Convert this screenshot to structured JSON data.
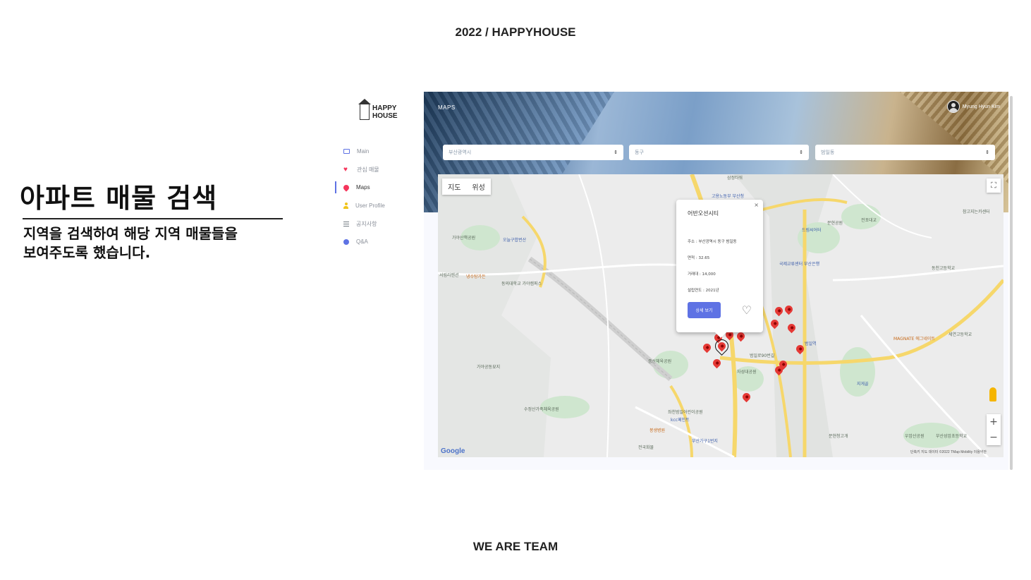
{
  "slide": {
    "header": "2022 / HAPPYHOUSE",
    "title": "아파트 매물 검색",
    "description_line1": "지역을 검색하여 해당 지역 매물들을",
    "description_line2": "보여주도록 했습니다.",
    "footer": "WE ARE TEAM"
  },
  "app": {
    "logo_line1": "HAPPY",
    "logo_line2": "HOUSE",
    "page_label": "MAPS",
    "user_name": "Myung Hyun Kim",
    "sidebar": {
      "items": [
        {
          "label": "Main",
          "icon": "monitor-icon",
          "color": "#5e72e4",
          "active": false
        },
        {
          "label": "관심 매물",
          "icon": "heart-icon",
          "color": "#f5365c",
          "active": false
        },
        {
          "label": "Maps",
          "icon": "map-pin-icon",
          "color": "#f5365c",
          "active": true
        },
        {
          "label": "User Profile",
          "icon": "user-icon",
          "color": "#f0c41b",
          "active": false
        },
        {
          "label": "공지사항",
          "icon": "list-icon",
          "color": "#6c757d",
          "active": false
        },
        {
          "label": "Q&A",
          "icon": "chat-bubble-icon",
          "color": "#5e72e4",
          "active": false
        }
      ]
    },
    "filters": {
      "city": "부산광역시",
      "district": "동구",
      "dong": "범일동"
    },
    "map": {
      "toggle_map": "지도",
      "toggle_satellite": "위성",
      "google_logo": "Google",
      "attribution": "단축키  지도 데이터 ©2022 TMap Mobility  이용약관",
      "labels": [
        "가야산책공원",
        "오늘구합번산",
        "서림라멘션",
        "냉수탕가든",
        "동의대학교 가야캠퍼스",
        "가야공동묘지",
        "수정산가족체육공원",
        "증산체육공원",
        "자성대공원",
        "범일로90번길",
        "kcc페인트",
        "봉생병원",
        "좌천범일어린이공원",
        "부산가구1번지",
        "전국화물",
        "문현공원",
        "전포대교",
        "동천고등학교",
        "MAGNATE 에그네이트",
        "세연고등학교",
        "지게골",
        "우암산공원",
        "부산성암초등학교",
        "문현청고개",
        "드림씨어터",
        "국제교류센터 부산은행",
        "참고지는카센터",
        "삼정타워",
        "고용노동부 부산청",
        "범일역"
      ],
      "accent_color": "#5e72e4",
      "pin_color": "#e53935",
      "marker_count": 14
    },
    "info_window": {
      "title": "어반오션시티",
      "address": "주소 : 부산광역시  동구  범일동",
      "area": "면적 : 32.65",
      "price": "거래대 : 14,000",
      "built_year": "설립연도 : 2021년",
      "detail_button": "상세 보기",
      "close": "×",
      "like_icon": "heart-outline-icon"
    }
  }
}
